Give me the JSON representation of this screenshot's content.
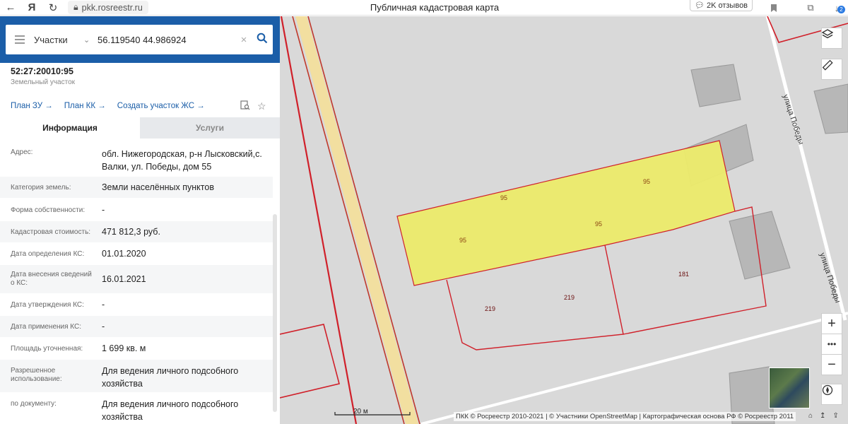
{
  "browser": {
    "url": "pkk.rosreestr.ru",
    "title": "Публичная кадастровая карта",
    "reviews": "2K отзывов",
    "downloads_badge": "2"
  },
  "search": {
    "type": "Участки",
    "value": "56.119540 44.986924"
  },
  "object": {
    "number": "52:27:20010:95",
    "type": "Земельный участок",
    "links": [
      "План ЗУ →",
      "План КК →",
      "Создать участок ЖС →"
    ]
  },
  "tabs": [
    "Информация",
    "Услуги"
  ],
  "info_rows": [
    {
      "label": "Адрес:",
      "value": "обл. Нижегородская, р-н Лысковский,с. Валки, ул. Победы, дом 55"
    },
    {
      "label": "Категория земель:",
      "value": "Земли населённых пунктов"
    },
    {
      "label": "Форма собственности:",
      "value": "-"
    },
    {
      "label": "Кадастровая стоимость:",
      "value": "471 812,3 руб."
    },
    {
      "label": "Дата определения КС:",
      "value": "01.01.2020"
    },
    {
      "label": "Дата внесения сведений о КС:",
      "value": "16.01.2021"
    },
    {
      "label": "Дата утверждения КС:",
      "value": "-"
    },
    {
      "label": "Дата применения КС:",
      "value": "-"
    },
    {
      "label": "Площадь уточненная:",
      "value": "1 699 кв. м"
    },
    {
      "label": "Разрешенное использование:",
      "value": "Для ведения личного подсобного хозяйства"
    },
    {
      "label": "по документу:",
      "value": "Для ведения личного подсобного хозяйства"
    }
  ],
  "map": {
    "street_label": "улица Победы",
    "parcel_labels": [
      "95",
      "95",
      "95",
      "95",
      "219",
      "219",
      "181"
    ],
    "scale": "20 м",
    "attribution": "ПКК © Росреестр 2010-2021 | © Участники OpenStreetMap | Картографическая основа РФ © Росреестр 2011",
    "colors": {
      "background": "#d9d9d9",
      "parcel_fill": "#eceb6a",
      "boundary": "#d0202a",
      "road": "#f2dfa0",
      "building": "#b7b7b7"
    }
  }
}
